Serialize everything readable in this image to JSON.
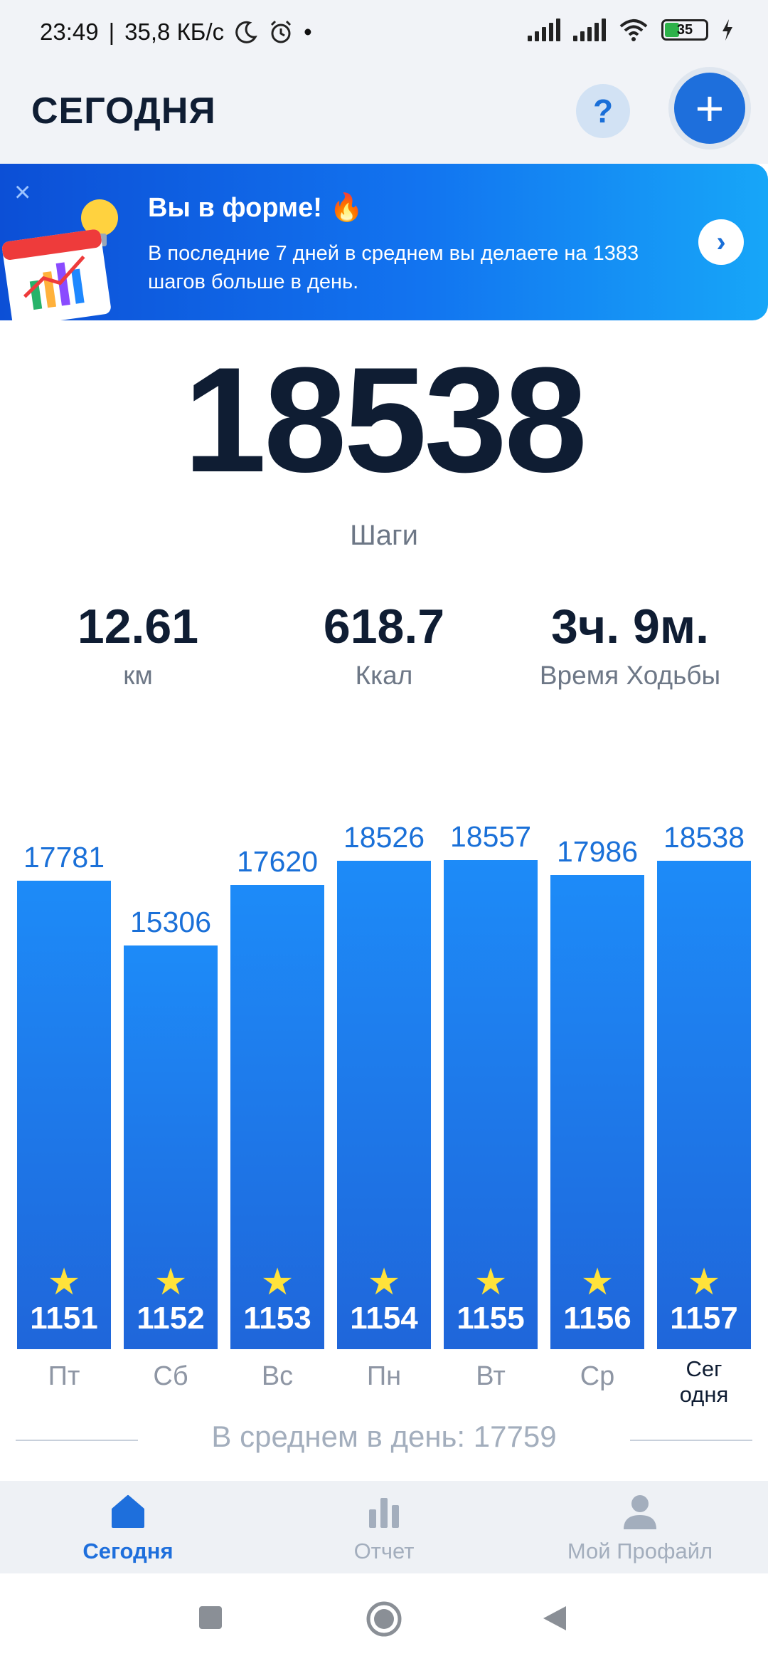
{
  "status_bar": {
    "time": "23:49",
    "speed": "35,8 КБ/с",
    "dot": "•",
    "battery": "35"
  },
  "header": {
    "title": "СЕГОДНЯ",
    "help": "?",
    "add": "+"
  },
  "banner": {
    "title": "Вы в форме! 🔥",
    "text": "В последние 7 дней в среднем вы делаете на 1383 шагов больше в день.",
    "close": "×",
    "arrow": "›"
  },
  "today": {
    "steps": "18538",
    "steps_label": "Шаги",
    "stats": [
      {
        "value": "12.61",
        "label": "км"
      },
      {
        "value": "618.7",
        "label": "Ккал"
      },
      {
        "value": "3ч. 9м.",
        "label": "Время Ходьбы"
      }
    ]
  },
  "chart_data": {
    "type": "bar",
    "categories": [
      "Пт",
      "Сб",
      "Вс",
      "Пн",
      "Вт",
      "Ср",
      "Сег одня"
    ],
    "values": [
      17781,
      15306,
      17620,
      18526,
      18557,
      17986,
      18538
    ],
    "bar_numbers": [
      "1151",
      "1152",
      "1153",
      "1154",
      "1155",
      "1156",
      "1157"
    ],
    "star": "★",
    "average_label": "В среднем в день: 17759",
    "today_label_lines": [
      "Сег",
      "одня"
    ]
  },
  "bottom_nav": {
    "items": [
      {
        "label": "Сегодня",
        "icon": "home-icon",
        "active": true
      },
      {
        "label": "Отчет",
        "icon": "bar-chart-icon",
        "active": false
      },
      {
        "label": "Мой Профайл",
        "icon": "person-icon",
        "active": false
      }
    ]
  },
  "colors": {
    "accent": "#1e6fdc",
    "bar_top": "#1d8bf8",
    "bar_bottom": "#1f66da",
    "star": "#ffe23a",
    "inactive_nav": "#a3aebd"
  }
}
